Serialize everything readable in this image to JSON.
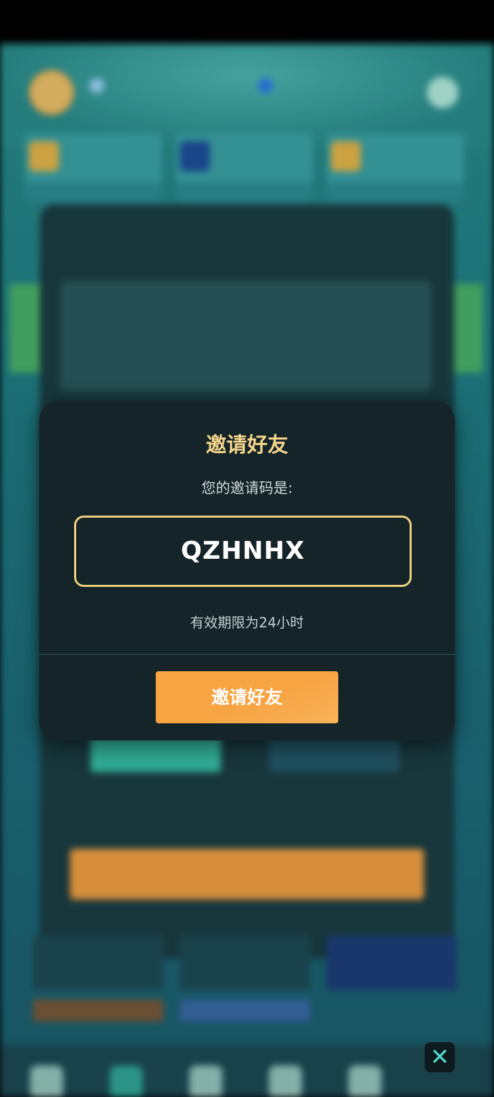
{
  "modal": {
    "title": "邀请好友",
    "subtitle": "您的邀请码是:",
    "invite_code": "QZHNHX",
    "validity_text": "有效期限为24小时",
    "invite_button_label": "邀请好友"
  },
  "close_icon": "close-icon",
  "colors": {
    "accent_gold": "#f5d58a",
    "button_orange": "#f7a443",
    "modal_bg": "#152429"
  }
}
